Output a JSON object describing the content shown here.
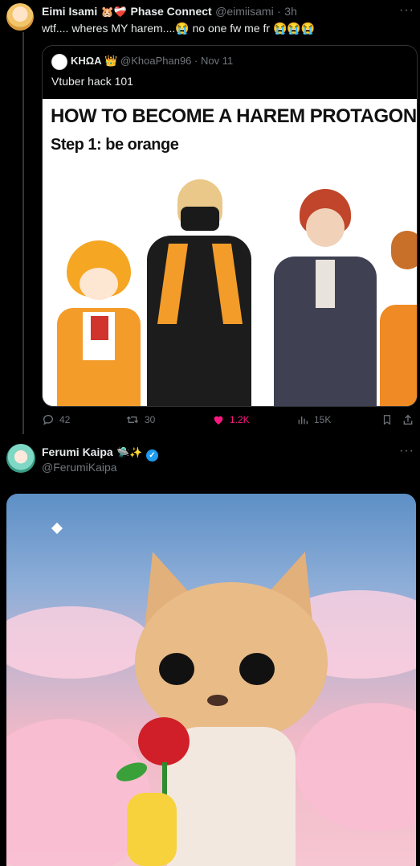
{
  "tweet1": {
    "display_name": "Eimi Isami",
    "name_emojis": "🐹❤️‍🩹",
    "affiliation": "Phase Connect",
    "handle": "@eimiisami",
    "time_sep": "·",
    "time": "3h",
    "text_part1": "wtf.... wheres MY harem....",
    "emoji1": "😭",
    "text_part2": " no one fw me fr ",
    "emoji2": "😭😭😭"
  },
  "quote": {
    "display_name": "ΚΗΩΑ",
    "crown": "👑",
    "handle": "@KhoaPhan96",
    "time_sep": "·",
    "date": "Nov 11",
    "text": "Vtuber hack 101",
    "meme_title": "HOW TO BECOME A HAREM PROTAGONIST?",
    "meme_step": "Step 1: be orange"
  },
  "actions": {
    "replies": "42",
    "reposts": "30",
    "likes": "1.2K",
    "views": "15K"
  },
  "tweet2": {
    "display_name": "Ferumi Kaipa",
    "name_emojis": "🛸✨",
    "verified": "✓",
    "handle": "@FerumiKaipa"
  },
  "colors": {
    "background": "#000000",
    "like_pink": "#f91880",
    "verified_blue": "#1d9bf0",
    "muted": "#71767b"
  },
  "icons": [
    "more-icon",
    "reply-icon",
    "repost-icon",
    "heart-icon",
    "views-icon",
    "bookmark-icon",
    "share-icon",
    "verified-icon"
  ]
}
